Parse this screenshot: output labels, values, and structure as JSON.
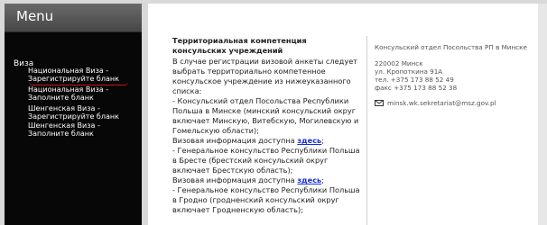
{
  "sidebar": {
    "title": "Menu",
    "section": "Виза",
    "items": [
      {
        "label": "Национальная Виза - Зарегистрируйте бланк"
      },
      {
        "label": "Национальная Виза - Заполните бланк"
      },
      {
        "label": "Шенгенская Виза - Зарегистрируйте бланк"
      },
      {
        "label": "Шенгенская Виза - Заполните бланк"
      }
    ]
  },
  "main": {
    "title": "Территориальная компетенция консульских учреждений",
    "intro": "В случае регистрации визовой анкеты следует выбрать территориально компетенное консульское учреждение из нижеуказанного списка:",
    "entries": [
      {
        "text": "- Консульский отдел Посольства Республики Польша в Минске (минский консульский округ включает Минскую, Витебскую, Могилевскую и Гомельскую области);",
        "info_prefix": "Визовая информация доступна ",
        "link": "здесь",
        "suffix": ";"
      },
      {
        "text": "- Генеральное консульство Республики Польша в Бресте (брестский консульский округ включает Брестскую область);",
        "info_prefix": "Визовая информация доступна ",
        "link": "здесь",
        "suffix": ";"
      },
      {
        "text": "- Генеральное консульство Республики Польша в Гродно (гродненский консульский округ включает Гродненскую область);"
      }
    ]
  },
  "contact": {
    "org": "Консульский отдел Посольства РП в Минске",
    "address_line1": "220002 Минск",
    "address_line2": "ул. Кропоткина 91А",
    "phone": "тел. +375 173 88 52 49",
    "fax": "факс +375 173 88 52 38",
    "email": "minsk.wk.sekretariat@msz.gov.pl",
    "email_icon": "mail-icon"
  },
  "colors": {
    "accent_link": "#1a2fd6",
    "sidebar_bg": "#070707",
    "underline": "#d0121b"
  }
}
